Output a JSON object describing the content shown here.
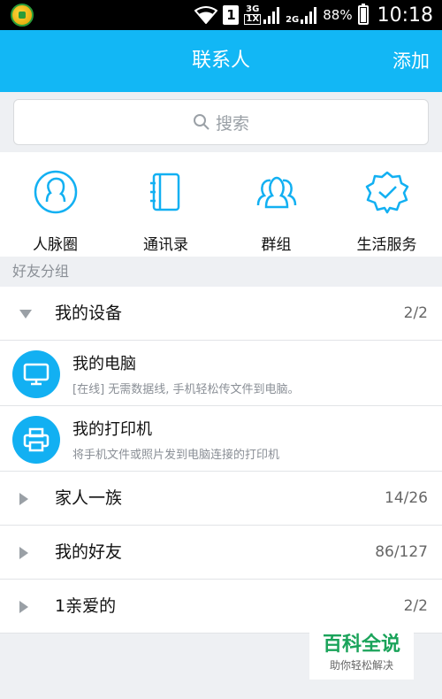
{
  "status_bar": {
    "signal_1": "1",
    "network_3g": "3G",
    "network_1x": "1X",
    "network_2g": "2G",
    "battery_percent": "88%",
    "battery_level": 0.88,
    "time": "10:18"
  },
  "header": {
    "title": "联系人",
    "add_label": "添加"
  },
  "search": {
    "placeholder": "搜索"
  },
  "quick_entries": [
    {
      "label": "人脉圈",
      "icon": "people-circle-icon"
    },
    {
      "label": "通讯录",
      "icon": "address-book-icon"
    },
    {
      "label": "群组",
      "icon": "group-icon"
    },
    {
      "label": "生活服务",
      "icon": "life-service-icon"
    }
  ],
  "section_label": "好友分组",
  "groups": {
    "my_devices": {
      "name": "我的设备",
      "count": "2/2"
    },
    "family": {
      "name": "家人一族",
      "count": "14/26"
    },
    "friends": {
      "name": "我的好友",
      "count": "86/127"
    },
    "dear": {
      "name": "1亲爱的",
      "count": "2/2"
    }
  },
  "devices": [
    {
      "name": "我的电脑",
      "desc": "[在线] 无需数据线, 手机轻松传文件到电脑。",
      "icon": "computer-icon"
    },
    {
      "name": "我的打印机",
      "desc": "将手机文件或照片发到电脑连接的打印机",
      "icon": "printer-icon"
    }
  ],
  "watermark": {
    "title": "百科全说",
    "subtitle": "助你轻松解决"
  },
  "colors": {
    "accent": "#12b7f5",
    "device_avatar": "#12b0f2",
    "background": "#eef0f3"
  }
}
